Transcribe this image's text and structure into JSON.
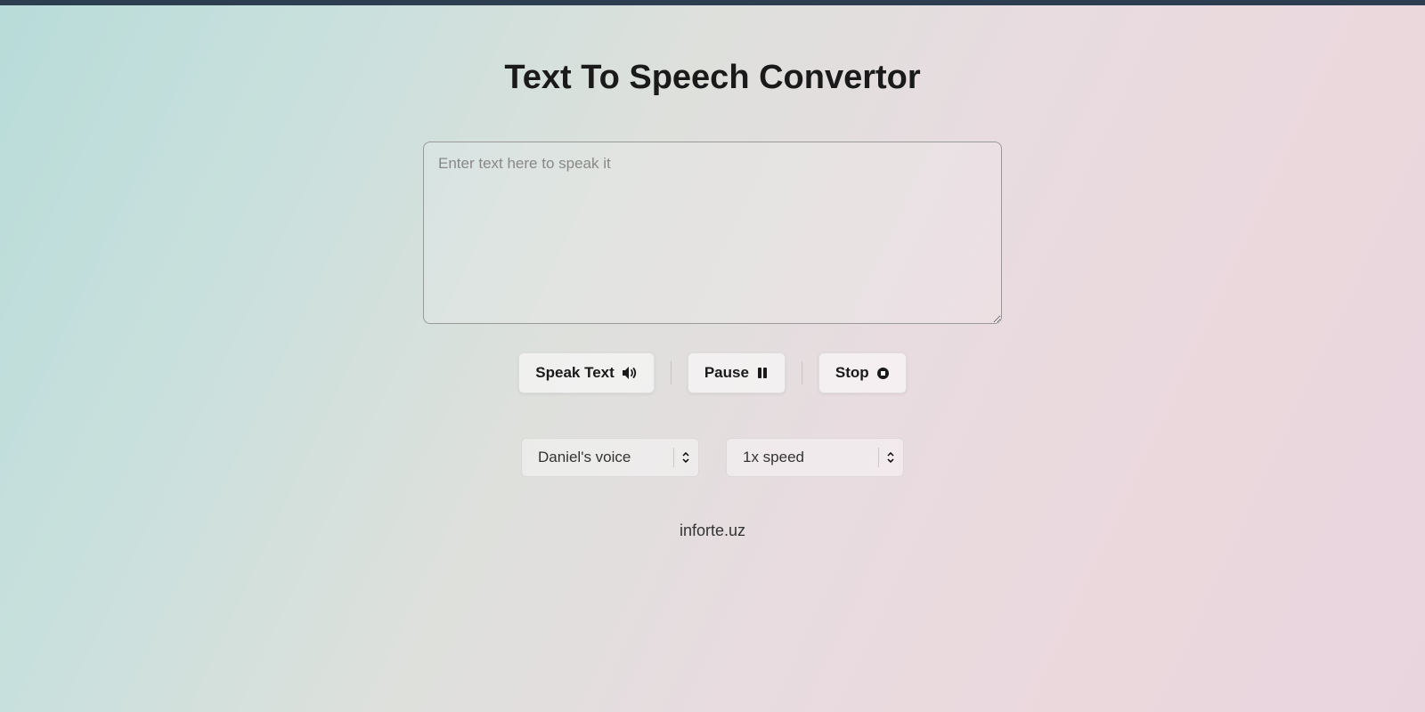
{
  "header": {
    "title": "Text To Speech Convertor"
  },
  "input": {
    "placeholder": "Enter text here to speak it",
    "value": ""
  },
  "buttons": {
    "speak": "Speak Text",
    "pause": "Pause",
    "stop": "Stop"
  },
  "selects": {
    "voice": "Daniel's voice",
    "speed": "1x speed"
  },
  "footer": {
    "text": "inforte.uz"
  }
}
